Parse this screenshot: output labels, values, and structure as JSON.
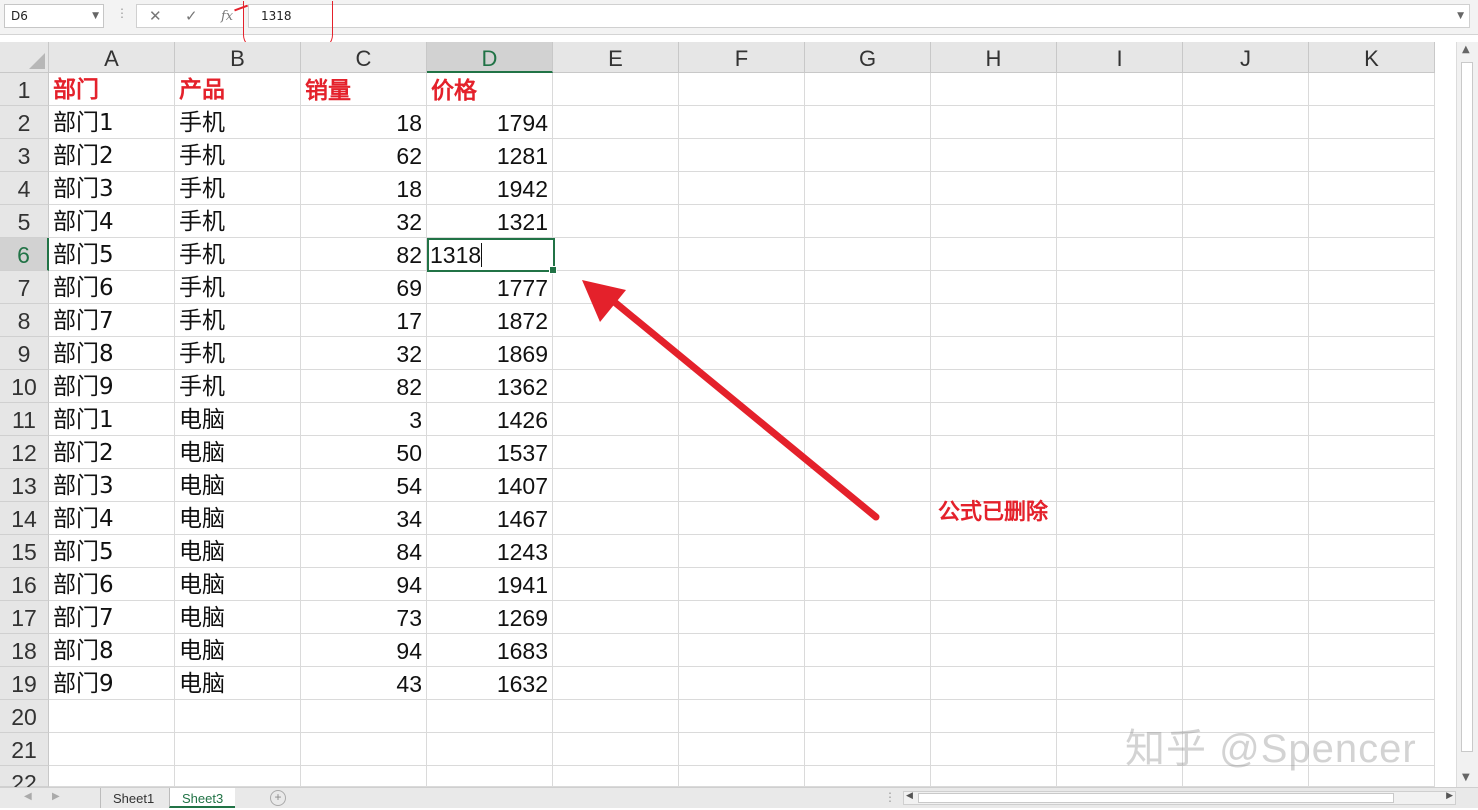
{
  "formula_bar": {
    "name_box": "D6",
    "cancel_icon": "✕",
    "enter_icon": "✓",
    "fx_label": "fx",
    "formula_value": "1318"
  },
  "columns": [
    "A",
    "B",
    "C",
    "D",
    "E",
    "F",
    "G",
    "H",
    "I",
    "J",
    "K"
  ],
  "selected_column": "D",
  "selected_row": 6,
  "rows": [
    [
      "部门",
      "产品",
      "销量",
      "价格"
    ],
    [
      "部门1",
      "手机",
      "18",
      "1794"
    ],
    [
      "部门2",
      "手机",
      "62",
      "1281"
    ],
    [
      "部门3",
      "手机",
      "18",
      "1942"
    ],
    [
      "部门4",
      "手机",
      "32",
      "1321"
    ],
    [
      "部门5",
      "手机",
      "82",
      "1318"
    ],
    [
      "部门6",
      "手机",
      "69",
      "1777"
    ],
    [
      "部门7",
      "手机",
      "17",
      "1872"
    ],
    [
      "部门8",
      "手机",
      "32",
      "1869"
    ],
    [
      "部门9",
      "手机",
      "82",
      "1362"
    ],
    [
      "部门1",
      "电脑",
      "3",
      "1426"
    ],
    [
      "部门2",
      "电脑",
      "50",
      "1537"
    ],
    [
      "部门3",
      "电脑",
      "54",
      "1407"
    ],
    [
      "部门4",
      "电脑",
      "34",
      "1467"
    ],
    [
      "部门5",
      "电脑",
      "84",
      "1243"
    ],
    [
      "部门6",
      "电脑",
      "94",
      "1941"
    ],
    [
      "部门7",
      "电脑",
      "73",
      "1269"
    ],
    [
      "部门8",
      "电脑",
      "94",
      "1683"
    ],
    [
      "部门9",
      "电脑",
      "43",
      "1632"
    ],
    [
      "",
      "",
      "",
      ""
    ],
    [
      "",
      "",
      "",
      ""
    ],
    [
      "",
      "",
      "",
      ""
    ]
  ],
  "row_numbers": [
    "1",
    "2",
    "3",
    "4",
    "5",
    "6",
    "7",
    "8",
    "9",
    "10",
    "11",
    "12",
    "13",
    "14",
    "15",
    "16",
    "17",
    "18",
    "19",
    "20",
    "21",
    "22"
  ],
  "active_cell_value": "1318",
  "sheet_tabs": [
    "Sheet1",
    "Sheet3"
  ],
  "active_sheet": "Sheet3",
  "annotation": "公式已删除",
  "watermark": "知乎 @Spencer",
  "colors": {
    "accent": "#217346",
    "annotation": "#e4212b"
  }
}
